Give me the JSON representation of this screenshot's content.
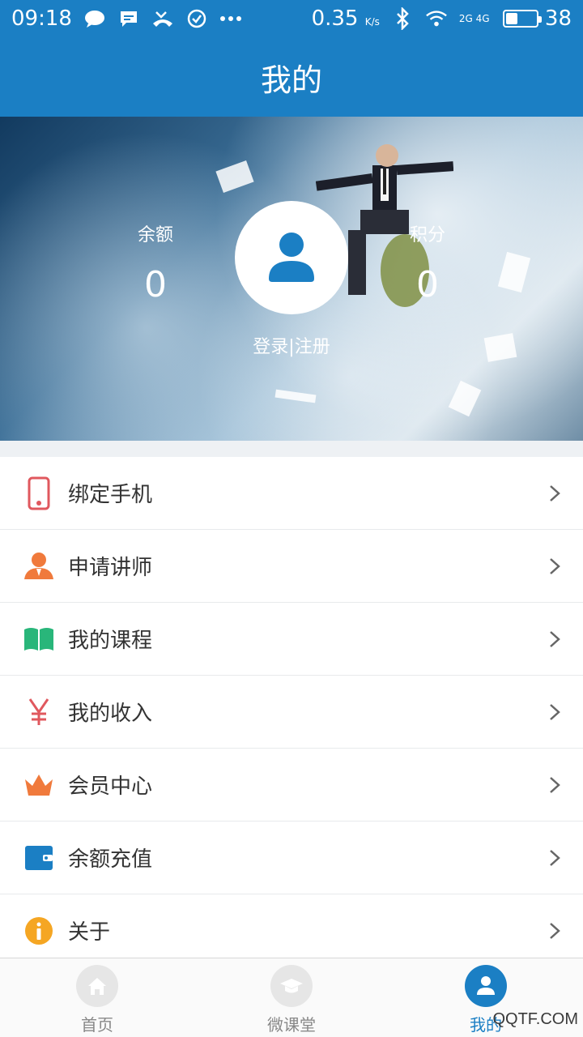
{
  "status_bar": {
    "time": "09:18",
    "speed": "0.35",
    "speed_unit": "K/s",
    "network": "2G 4G",
    "battery": "38",
    "battery_level": 0.38
  },
  "header": {
    "title": "我的"
  },
  "profile": {
    "balance_label": "余额",
    "balance_value": "0",
    "points_label": "积分",
    "points_value": "0",
    "login_link": "登录|注册"
  },
  "menu": {
    "items": [
      {
        "label": "绑定手机",
        "icon": "phone-icon",
        "color": "#e0585e"
      },
      {
        "label": "申请讲师",
        "icon": "lecturer-icon",
        "color": "#f07a3c"
      },
      {
        "label": "我的课程",
        "icon": "book-icon",
        "color": "#29b67a"
      },
      {
        "label": "我的收入",
        "icon": "yen-icon",
        "color": "#e0585e"
      },
      {
        "label": "会员中心",
        "icon": "crown-icon",
        "color": "#f07a3c"
      },
      {
        "label": "余额充值",
        "icon": "wallet-icon",
        "color": "#1b7fc4"
      },
      {
        "label": "关于",
        "icon": "info-icon",
        "color": "#f5a623"
      }
    ]
  },
  "bottom_nav": {
    "tabs": [
      {
        "label": "首页",
        "icon": "home-icon"
      },
      {
        "label": "微课堂",
        "icon": "graduation-cap-icon"
      },
      {
        "label": "我的",
        "icon": "user-icon",
        "active": true
      }
    ]
  },
  "watermark": "QQTF.COM",
  "colors": {
    "primary": "#1b7fc4",
    "text": "#333333",
    "chevron": "#666666"
  }
}
